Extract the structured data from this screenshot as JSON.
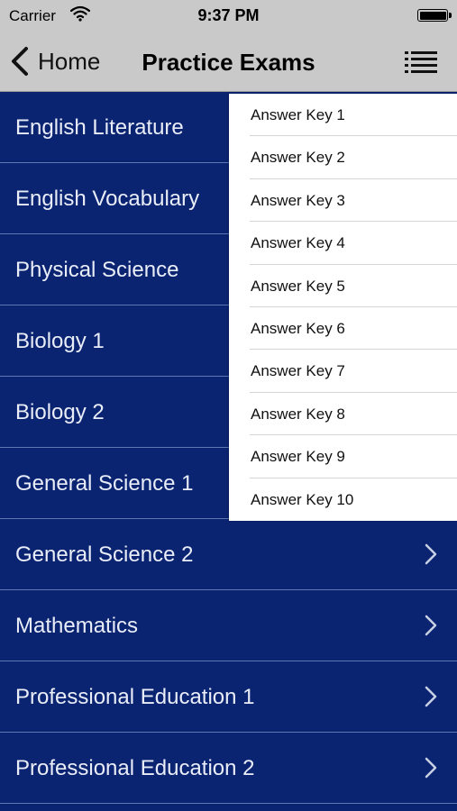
{
  "status_bar": {
    "carrier": "Carrier",
    "time": "9:37 PM"
  },
  "nav": {
    "back_label": "Home",
    "title": "Practice Exams"
  },
  "exams": [
    {
      "label": "English Literature"
    },
    {
      "label": "English Vocabulary"
    },
    {
      "label": "Physical Science"
    },
    {
      "label": "Biology 1"
    },
    {
      "label": "Biology 2"
    },
    {
      "label": "General Science 1"
    },
    {
      "label": "General Science 2"
    },
    {
      "label": "Mathematics"
    },
    {
      "label": "Professional Education 1"
    },
    {
      "label": "Professional Education 2"
    }
  ],
  "answer_keys": [
    {
      "label": "Answer Key 1"
    },
    {
      "label": "Answer Key 2"
    },
    {
      "label": "Answer Key 3"
    },
    {
      "label": "Answer Key 4"
    },
    {
      "label": "Answer Key 5"
    },
    {
      "label": "Answer Key 6"
    },
    {
      "label": "Answer Key 7"
    },
    {
      "label": "Answer Key 8"
    },
    {
      "label": "Answer Key 9"
    },
    {
      "label": "Answer Key 10"
    }
  ],
  "icons": {
    "back": "chevron-left-icon",
    "menu": "list-icon",
    "row_disclosure": "chevron-right-icon",
    "wifi": "wifi-icon",
    "battery": "battery-icon"
  },
  "colors": {
    "list_background": "#0b2472",
    "row_separator": "#5f76b0",
    "nav_background": "#c9c9c9",
    "dropdown_background": "#ffffff"
  }
}
